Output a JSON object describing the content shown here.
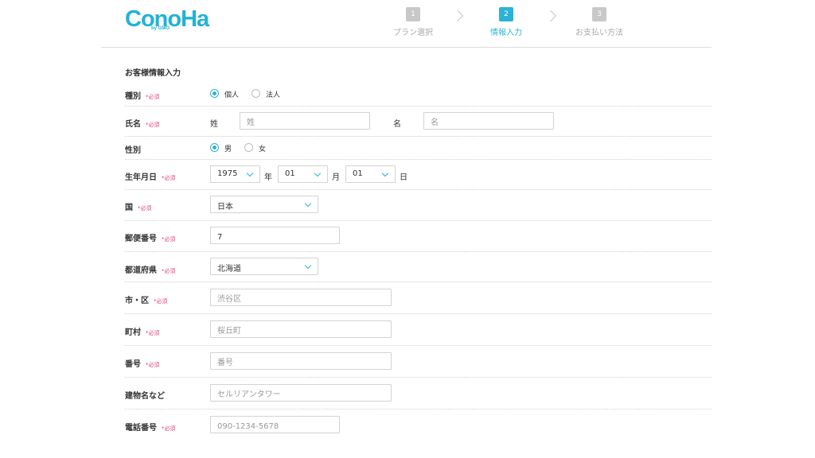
{
  "header": {
    "logo": {
      "main": "ConoHa",
      "sub": "by GMO"
    },
    "steps": [
      {
        "num": "1",
        "label": "プラン選択"
      },
      {
        "num": "2",
        "label": "情報入力"
      },
      {
        "num": "3",
        "label": "お支払い方法"
      }
    ]
  },
  "form": {
    "title": "お客様情報入力",
    "required_mark": "*必須",
    "type": {
      "label": "種別",
      "options": [
        "個人",
        "法人"
      ]
    },
    "name": {
      "label": "氏名",
      "last_label": "姓",
      "last_placeholder": "姓",
      "first_label": "名",
      "first_placeholder": "名"
    },
    "gender": {
      "label": "性別",
      "options": [
        "男",
        "女"
      ]
    },
    "birthday": {
      "label": "生年月日",
      "year": "1975",
      "year_unit": "年",
      "month": "01",
      "month_unit": "月",
      "day": "01",
      "day_unit": "日"
    },
    "country": {
      "label": "国",
      "value": "日本"
    },
    "postal": {
      "label": "郵便番号",
      "value": "7"
    },
    "prefecture": {
      "label": "都道府県",
      "value": "北海道"
    },
    "city": {
      "label": "市・区",
      "placeholder": "渋谷区"
    },
    "town": {
      "label": "町村",
      "placeholder": "桜丘町"
    },
    "address_number": {
      "label": "番号",
      "placeholder": "番号"
    },
    "building": {
      "label": "建物名など",
      "placeholder": "セルリアンタワー"
    },
    "phone": {
      "label": "電話番号",
      "placeholder": "090-1234-5678"
    }
  },
  "colors": {
    "accent": "#2bb3d6",
    "required": "#e04a74",
    "logo": "#22b2d6"
  }
}
